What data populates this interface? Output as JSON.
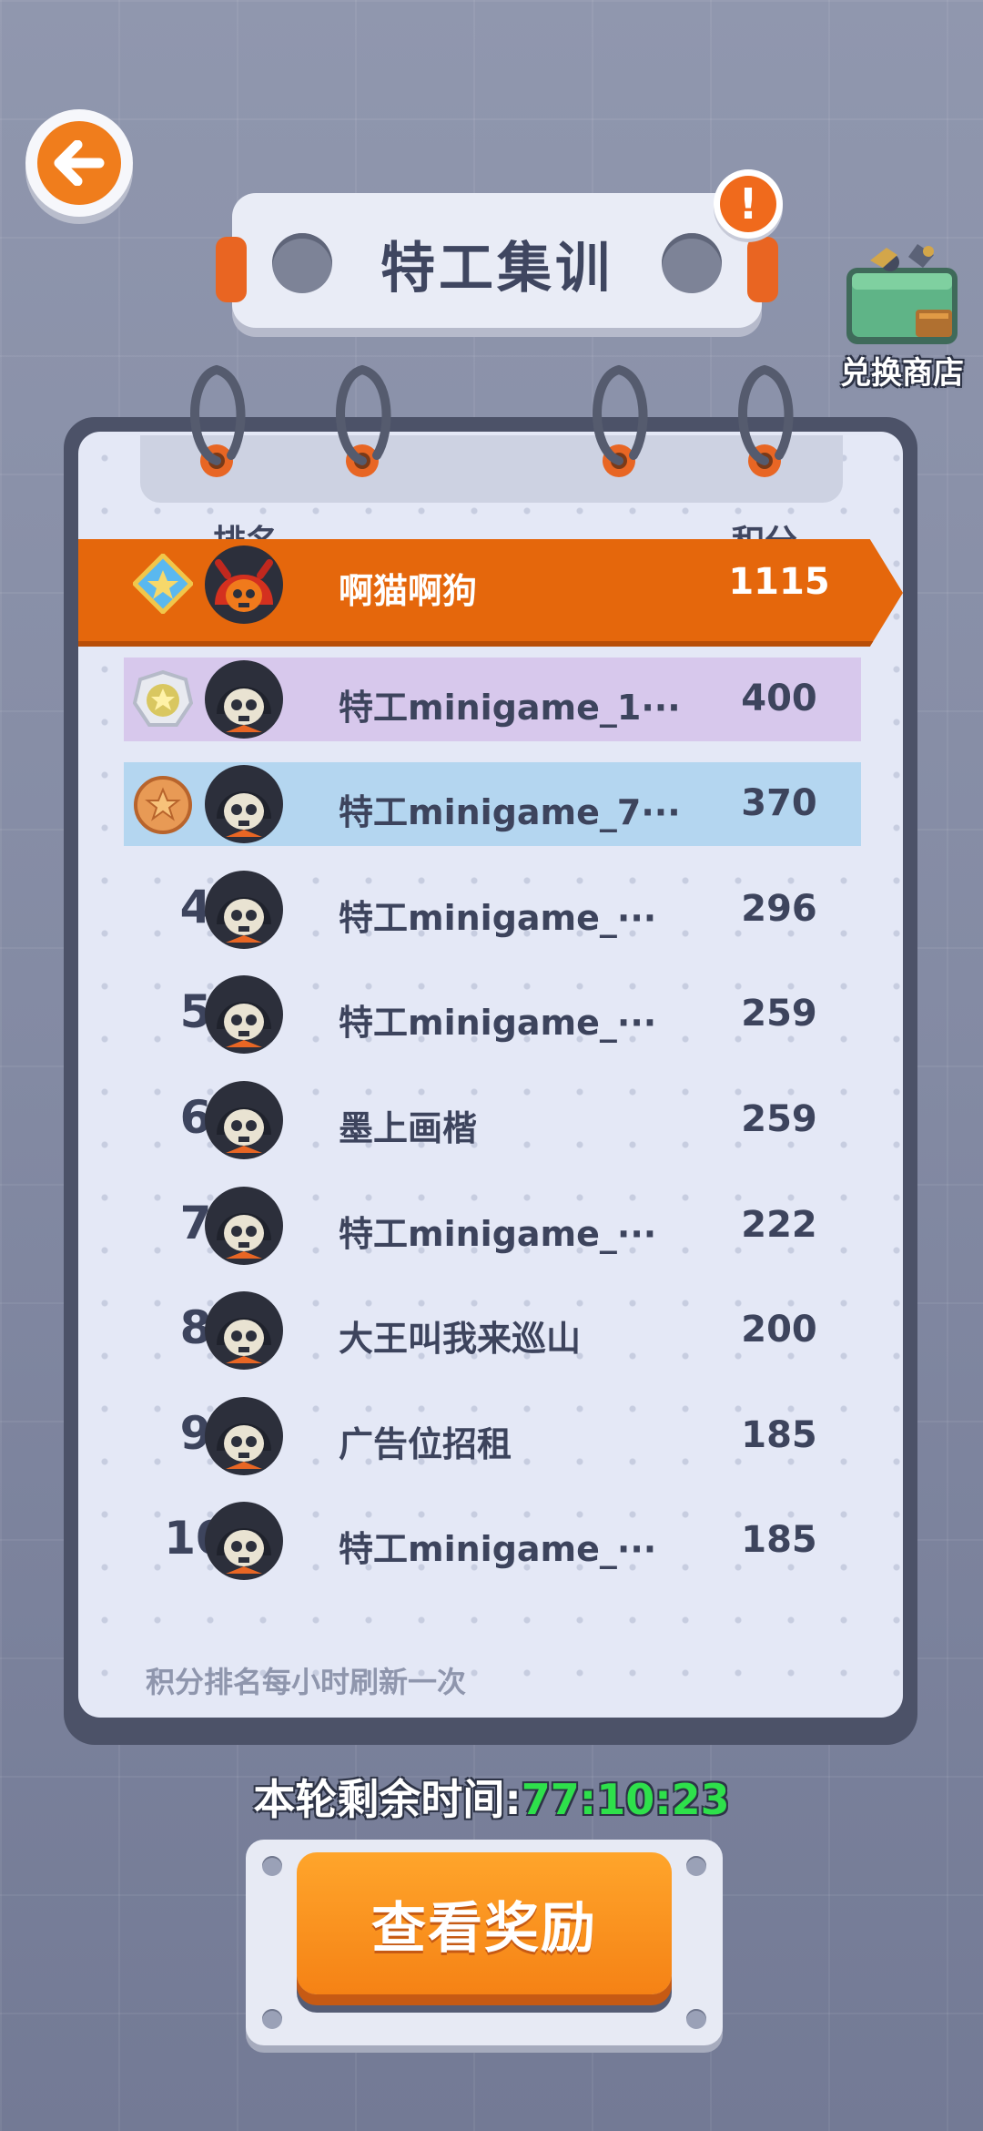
{
  "header": {
    "title": "特工集训",
    "shop_label": "兑换商店"
  },
  "table": {
    "col_rank": "排名",
    "col_score": "积分",
    "rows": [
      {
        "rank": "",
        "name": "啊猫啊狗",
        "score": "1115",
        "medal": "diamond",
        "band": "#e5670c",
        "avatar": "red-devil"
      },
      {
        "rank": "",
        "name": "特工minigame_1···",
        "score": "400",
        "medal": "silver",
        "band": "#d7c8ec",
        "avatar": "skull"
      },
      {
        "rank": "",
        "name": "特工minigame_7···",
        "score": "370",
        "medal": "bronze",
        "band": "#b4d6f0",
        "avatar": "skull"
      },
      {
        "rank": "4",
        "name": "特工minigame_···",
        "score": "296",
        "avatar": "skull"
      },
      {
        "rank": "5",
        "name": "特工minigame_···",
        "score": "259",
        "avatar": "skull"
      },
      {
        "rank": "6",
        "name": "墨上画楷",
        "score": "259",
        "avatar": "skull"
      },
      {
        "rank": "7",
        "name": "特工minigame_···",
        "score": "222",
        "avatar": "skull"
      },
      {
        "rank": "8",
        "name": "大王叫我来巡山",
        "score": "200",
        "avatar": "skull"
      },
      {
        "rank": "9",
        "name": "广告位招租",
        "score": "185",
        "avatar": "skull"
      },
      {
        "rank": "10",
        "name": "特工minigame_···",
        "score": "185",
        "avatar": "skull"
      }
    ],
    "footer_note": "积分排名每小时刷新一次"
  },
  "timer": {
    "label": "本轮剩余时间:",
    "value": "77:10:23"
  },
  "reward_button": "查看奖励",
  "colors": {
    "accent_orange": "#f07d1c",
    "timer_green": "#2ee04b",
    "text_dark": "#3d445d"
  }
}
